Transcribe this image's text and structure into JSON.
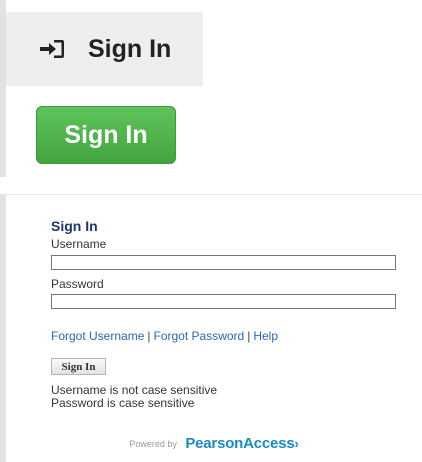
{
  "top": {
    "header_title": "Sign In",
    "primary_button_label": "Sign In",
    "header_icon": "sign-in-icon"
  },
  "form": {
    "title": "Sign In",
    "username_label": "Username",
    "username_value": "",
    "password_label": "Password",
    "password_value": "",
    "forgot_username": "Forgot Username",
    "separator": "|",
    "forgot_password": "Forgot Password",
    "help": "Help",
    "submit_label": "Sign In",
    "note_username": "Username is not case sensitive",
    "note_password": "Password is case sensitive"
  },
  "footer": {
    "powered_by": "Powered by",
    "brand_pearson": "Pearson",
    "brand_access": "Access",
    "brand_chevron": "›"
  },
  "colors": {
    "green_button": "#4caf48",
    "title_blue": "#1b3a6a",
    "link_blue": "#2a67b8",
    "brand_blue": "#1a8ac6"
  }
}
